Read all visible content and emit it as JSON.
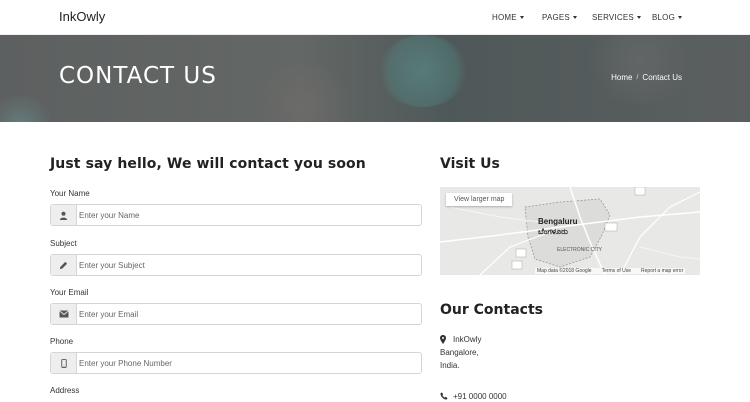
{
  "navbar": {
    "brand": "InkOwly",
    "items": [
      {
        "label": "HOME"
      },
      {
        "label": "PAGES"
      },
      {
        "label": "SERVICES"
      },
      {
        "label": "BLOG"
      }
    ]
  },
  "hero": {
    "title": "CONTACT US",
    "breadcrumb": {
      "home": "Home",
      "separator": "/",
      "current": "Contact Us"
    }
  },
  "form": {
    "heading": "Just say hello, We will contact you soon",
    "fields": [
      {
        "label": "Your Name",
        "placeholder": "Enter your Name",
        "icon": "user-icon"
      },
      {
        "label": "Subject",
        "placeholder": "Enter your Subject",
        "icon": "pencil-icon"
      },
      {
        "label": "Your Email",
        "placeholder": "Enter your Email",
        "icon": "envelope-icon"
      },
      {
        "label": "Phone",
        "placeholder": "Enter your Phone Number",
        "icon": "mobile-icon"
      },
      {
        "label": "Address"
      }
    ]
  },
  "visit": {
    "heading": "Visit Us",
    "map": {
      "button": "View larger map",
      "city_en": "Bengaluru",
      "city_kn": "ಬೆಂಗಳೂರು",
      "area": "ELECTRONIC CITY",
      "footer": {
        "data": "Map data ©2018 Google",
        "terms": "Terms of Use",
        "report": "Report a map error"
      }
    }
  },
  "contacts": {
    "heading": "Our Contacts",
    "address": [
      "InkOwly",
      "Bangalore,",
      "India."
    ],
    "phone": "+91 0000 0000"
  }
}
